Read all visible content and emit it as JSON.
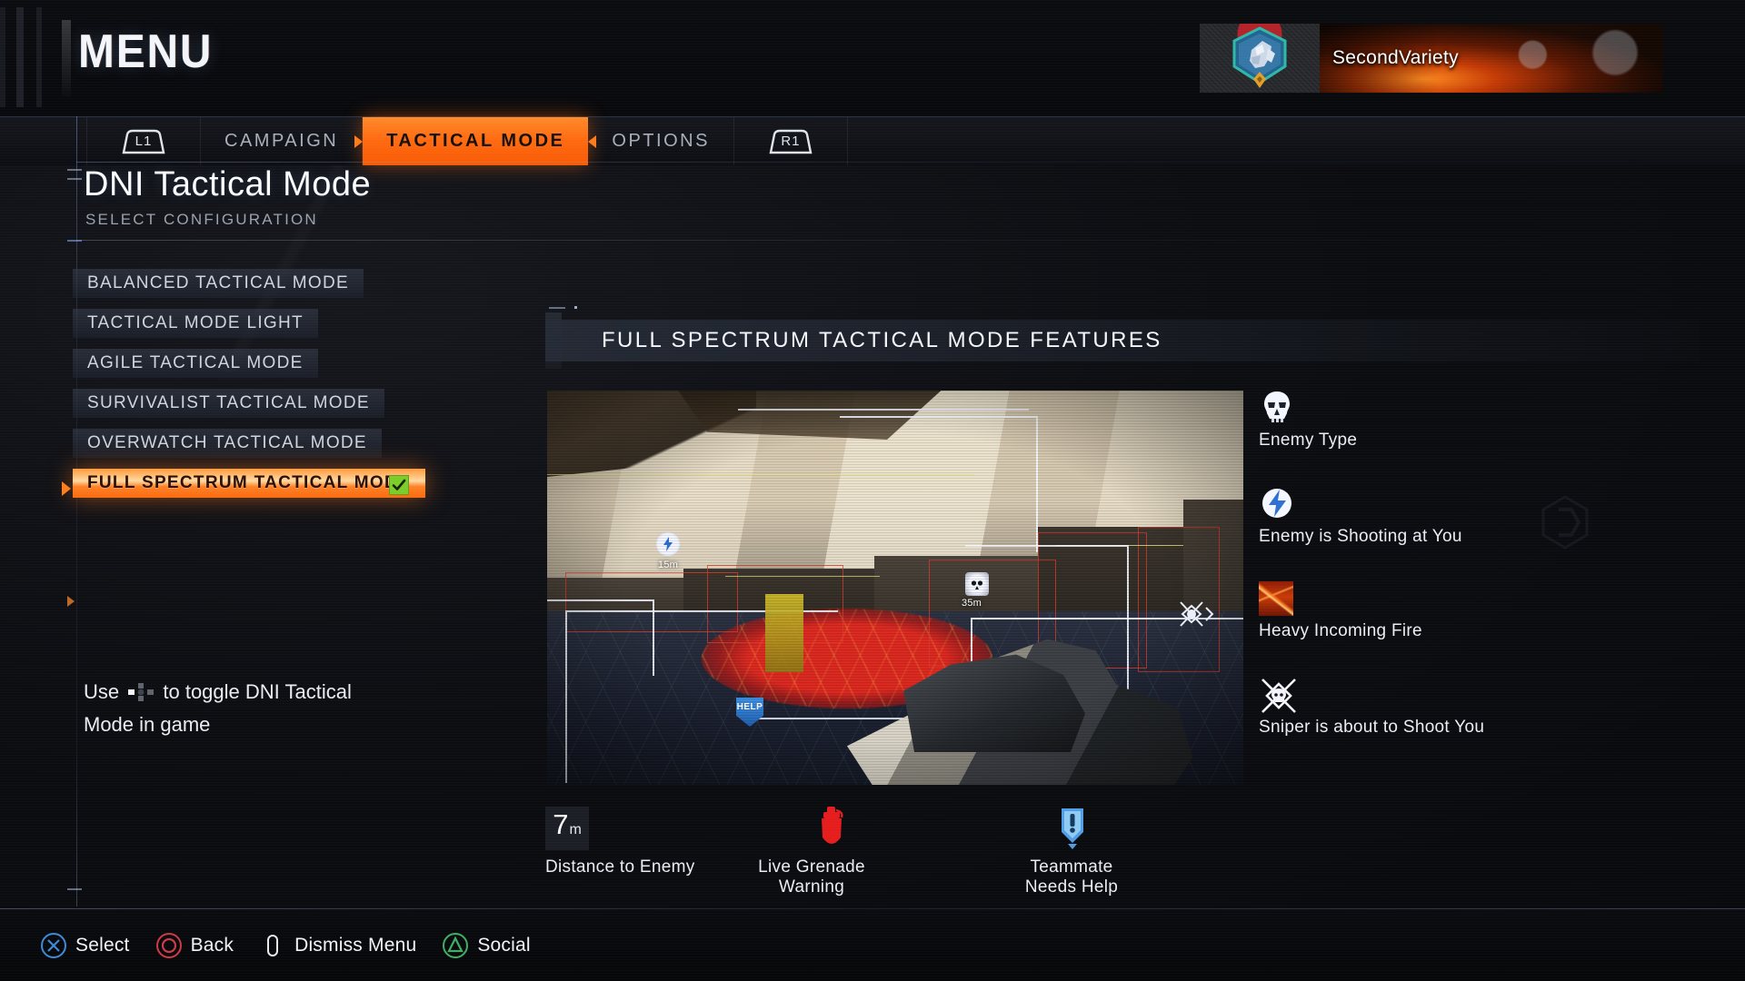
{
  "header": {
    "menu_title": "MENU",
    "player": {
      "gamertag": "SecondVariety",
      "emblem_name": "lion-crest-emblem"
    }
  },
  "nav": {
    "left_bumper": "L1",
    "right_bumper": "R1",
    "tabs": [
      {
        "label": "CAMPAIGN",
        "active": false
      },
      {
        "label": "TACTICAL MODE",
        "active": true
      },
      {
        "label": "OPTIONS",
        "active": false
      }
    ],
    "accent_color": "#ff6f12"
  },
  "page": {
    "title": "DNI Tactical Mode",
    "subtitle": "SELECT CONFIGURATION"
  },
  "config_list": [
    {
      "label": "BALANCED TACTICAL MODE",
      "selected": false,
      "checked": false
    },
    {
      "label": "TACTICAL MODE LIGHT",
      "selected": false,
      "checked": false
    },
    {
      "label": "AGILE TACTICAL MODE",
      "selected": false,
      "checked": false
    },
    {
      "label": "SURVIVALIST TACTICAL MODE",
      "selected": false,
      "checked": false
    },
    {
      "label": "OVERWATCH TACTICAL MODE",
      "selected": false,
      "checked": false
    },
    {
      "label": "FULL SPECTRUM TACTICAL MODE",
      "selected": true,
      "checked": true
    }
  ],
  "help": {
    "line1_before": "Use",
    "icon": "dpad-left-icon",
    "line1_after": "to toggle DNI Tactical",
    "line2": "Mode in game"
  },
  "features_panel": {
    "title": "FULL SPECTRUM TACTICAL MODE FEATURES",
    "screenshot_overlays": {
      "enemy_distance_near": "15m",
      "enemy_distance_far": "35m",
      "help_badge": "HELP"
    },
    "side_legend": [
      {
        "icon": "skull-icon",
        "label": "Enemy Type"
      },
      {
        "icon": "lightning-bolt-icon",
        "label": "Enemy is Shooting at You"
      },
      {
        "icon": "tracer-fire-icon",
        "label": "Heavy Incoming Fire"
      },
      {
        "icon": "sniper-skull-icon",
        "label": "Sniper is about to Shoot You"
      }
    ],
    "bottom_legend": [
      {
        "icon": "distance-chip",
        "value": "7",
        "unit": "m",
        "label": "Distance to Enemy"
      },
      {
        "icon": "grenade-icon",
        "label": "Live Grenade Warning"
      },
      {
        "icon": "teammate-help-icon",
        "label": "Teammate Needs Help"
      }
    ]
  },
  "footer": {
    "buttons": [
      {
        "glyph": "cross-button-icon",
        "label": "Select",
        "color": "#3d8ad8"
      },
      {
        "glyph": "circle-button-icon",
        "label": "Back",
        "color": "#cc3a44"
      },
      {
        "glyph": "options-button-icon",
        "label": "Dismiss Menu",
        "color": "#e6eaf0"
      },
      {
        "glyph": "triangle-button-icon",
        "label": "Social",
        "color": "#3fae62"
      }
    ]
  }
}
